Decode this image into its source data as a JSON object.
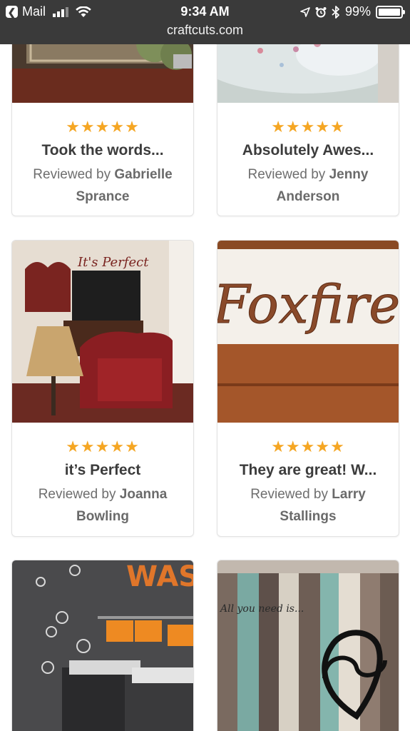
{
  "status_bar": {
    "back_app": "Mail",
    "time": "9:34 AM",
    "battery": "99%",
    "battery_level": 0.99,
    "url": "craftcuts.com"
  },
  "reviews": [
    {
      "title": "Took the words...",
      "prefix": "Reviewed by",
      "name": "Gabrielle Sprance",
      "stars": "★★★★★",
      "rating": 5
    },
    {
      "title": "Absolutely Awes...",
      "prefix": "Reviewed by",
      "name": "Jenny Anderson",
      "stars": "★★★★★",
      "rating": 5
    },
    {
      "title": "it’s Perfect",
      "prefix": "Reviewed by",
      "name": "Joanna Bowling",
      "stars": "★★★★★",
      "rating": 5,
      "photo_text": "It's Perfect"
    },
    {
      "title": "They are great! W...",
      "prefix": "Reviewed by",
      "name": "Larry Stallings",
      "stars": "★★★★★",
      "rating": 5,
      "photo_text": "Foxfire"
    },
    {
      "photo_text": "WAS"
    },
    {
      "photo_text": "All you need is..."
    }
  ],
  "colors": {
    "star": "#f5a623",
    "status_bar": "#3a3a3a"
  }
}
